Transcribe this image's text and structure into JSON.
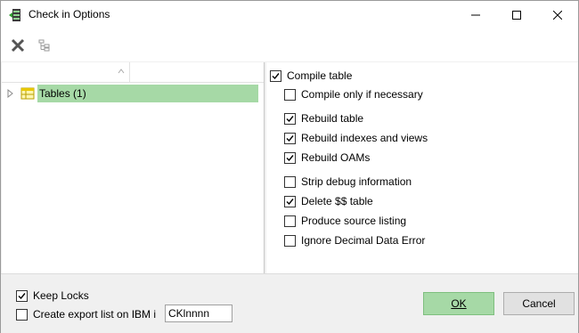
{
  "window": {
    "title": "Check in Options"
  },
  "toolbar": {
    "delete_icon": "delete-x-icon",
    "tree_icon": "tree-structure-icon"
  },
  "tree": {
    "items": [
      {
        "label": "Tables (1)",
        "selected": true
      }
    ]
  },
  "options": {
    "compile_table": {
      "label": "Compile table",
      "checked": true
    },
    "compile_only_if_necessary": {
      "label": "Compile only if necessary",
      "checked": false
    },
    "rebuild_table": {
      "label": "Rebuild table",
      "checked": true
    },
    "rebuild_indexes": {
      "label": "Rebuild indexes and views",
      "checked": true
    },
    "rebuild_oams": {
      "label": "Rebuild OAMs",
      "checked": true
    },
    "strip_debug": {
      "label": "Strip debug information",
      "checked": false
    },
    "delete_ss_table": {
      "label": "Delete $$ table",
      "checked": true
    },
    "produce_source_listing": {
      "label": "Produce source listing",
      "checked": false
    },
    "ignore_decimal": {
      "label": "Ignore Decimal Data Error",
      "checked": false
    }
  },
  "bottom": {
    "keep_locks": {
      "label": "Keep Locks",
      "checked": true
    },
    "create_export": {
      "label": "Create export list on IBM i",
      "checked": false
    },
    "export_value": "CKlnnnn"
  },
  "buttons": {
    "ok": "OK",
    "cancel": "Cancel"
  },
  "colors": {
    "selection_green": "#a6d9a6",
    "ok_button": "#a6d9a6"
  }
}
